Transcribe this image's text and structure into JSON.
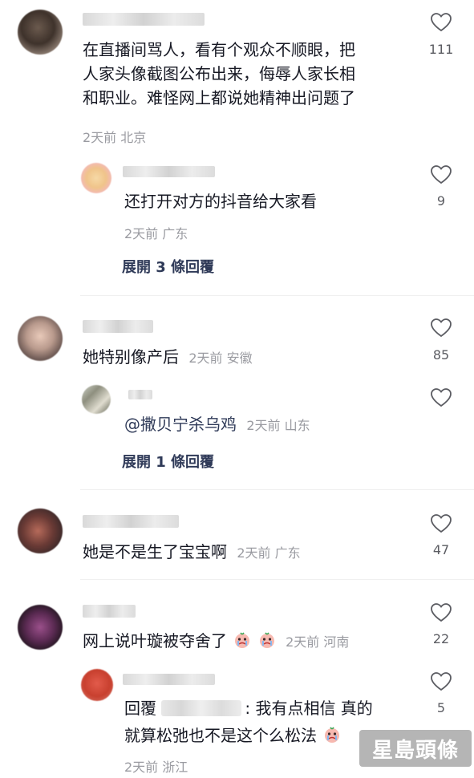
{
  "comments": [
    {
      "text_lines": [
        "在直播间骂人，看有个观众不顺眼，把",
        "人家头像截图公布出来，侮辱人家长相",
        "和职业。难怪网上都说她精神出问题了"
      ],
      "meta": "2天前 北京",
      "likes": "111",
      "reply": {
        "text": "还打开对方的抖音给大家看",
        "meta": "2天前 广东",
        "likes": "9"
      },
      "expand": "展開 3 條回覆"
    },
    {
      "text": "她特别像产后",
      "meta": "2天前 安徽",
      "likes": "85",
      "reply": {
        "text": "@撒贝宁杀乌鸡",
        "meta": "2天前 山东",
        "likes": ""
      },
      "expand": "展開 1 條回覆"
    },
    {
      "text": "她是不是生了宝宝啊",
      "meta": "2天前 广东",
      "likes": "47"
    },
    {
      "text": "网上说叶璇被夺舍了",
      "meta": "2天前 河南",
      "likes": "22",
      "reply": {
        "prefix": "回覆",
        "text_a": ": 我有点相信 真的",
        "text_b": "就算松弛也不是这个么松法",
        "meta": "2天前 浙江",
        "likes": "5"
      }
    }
  ],
  "watermark": "星島頭條",
  "colors": {
    "text": "#161823",
    "meta": "#9a9ba1",
    "expand": "#2f3a58"
  }
}
